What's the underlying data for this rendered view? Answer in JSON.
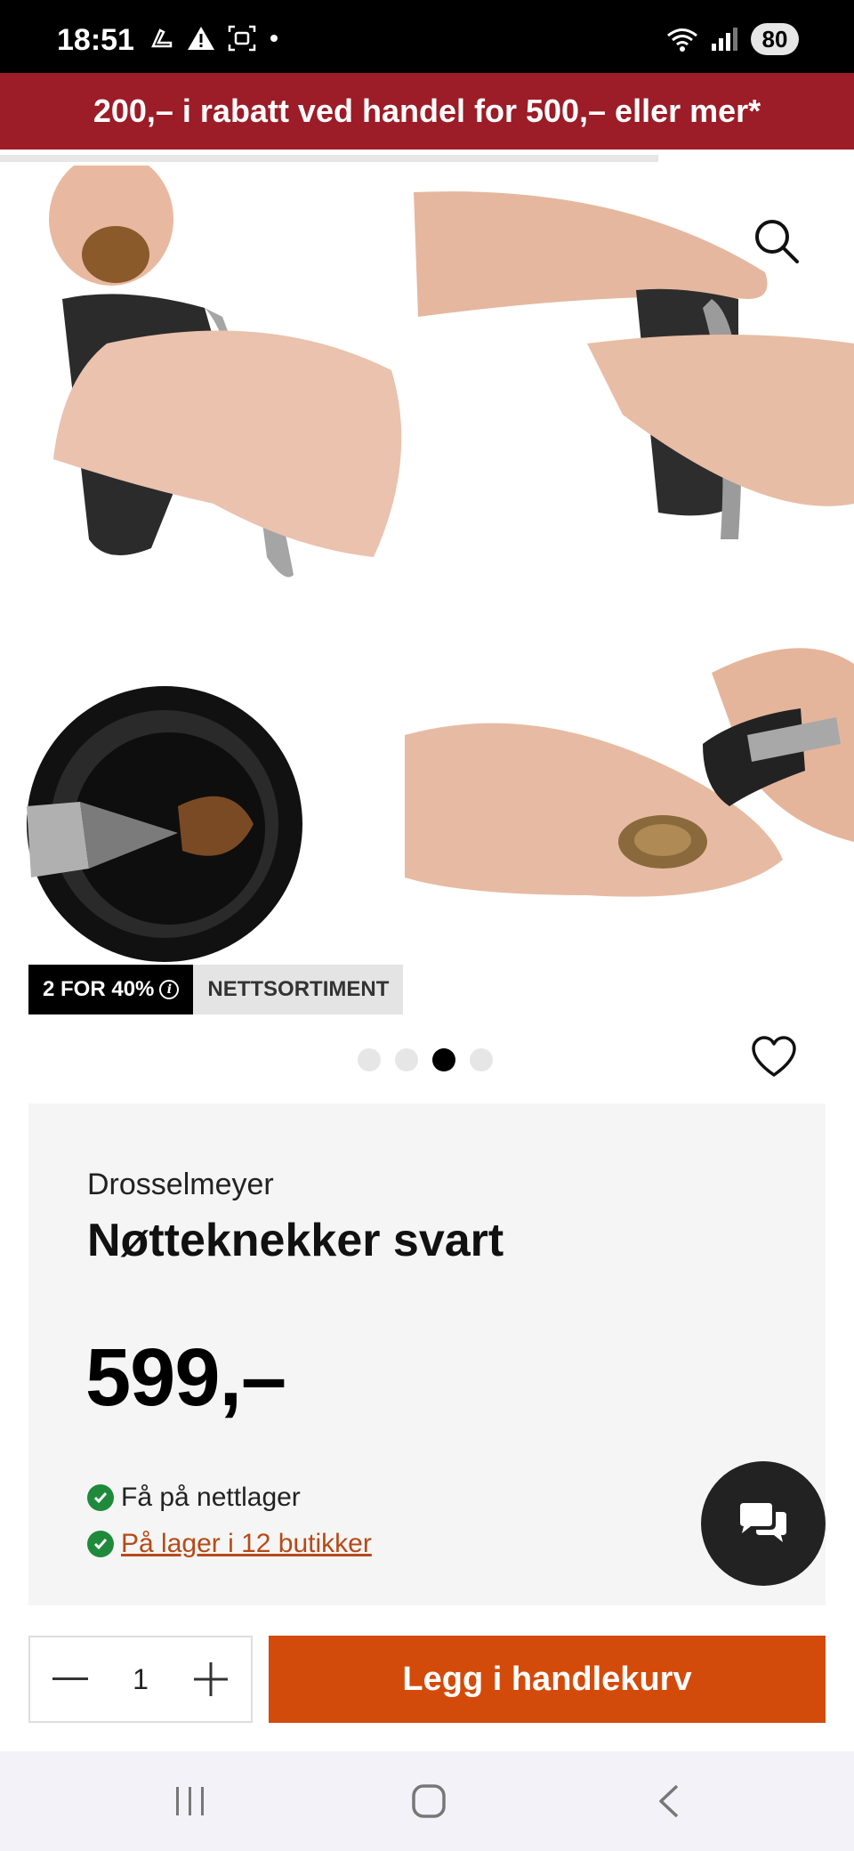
{
  "status_bar": {
    "time": "18:51",
    "battery": "80",
    "icons": [
      "boot-icon",
      "warning-icon",
      "screenshot-icon",
      "dot-icon",
      "wifi-icon",
      "signal-icon"
    ]
  },
  "promo": {
    "text": "200,– i rabatt ved handel for 500,– eller mer*"
  },
  "gallery": {
    "badges": {
      "discount": "2 FOR 40%",
      "web_only": "NETTSORTIMENT"
    },
    "dot_count": 4,
    "active_dot": 3
  },
  "product": {
    "brand": "Drosselmeyer",
    "title": "Nøtteknekker svart",
    "price": "599,–",
    "stock_online": "Få på nettlager",
    "stock_stores": "På lager i 12 butikker"
  },
  "cart": {
    "quantity": "1",
    "add_label": "Legg i handlekurv"
  },
  "colors": {
    "promo_bg": "#9c1c27",
    "cta": "#d34b0b",
    "link": "#b64a17",
    "check": "#1f8a3b"
  }
}
